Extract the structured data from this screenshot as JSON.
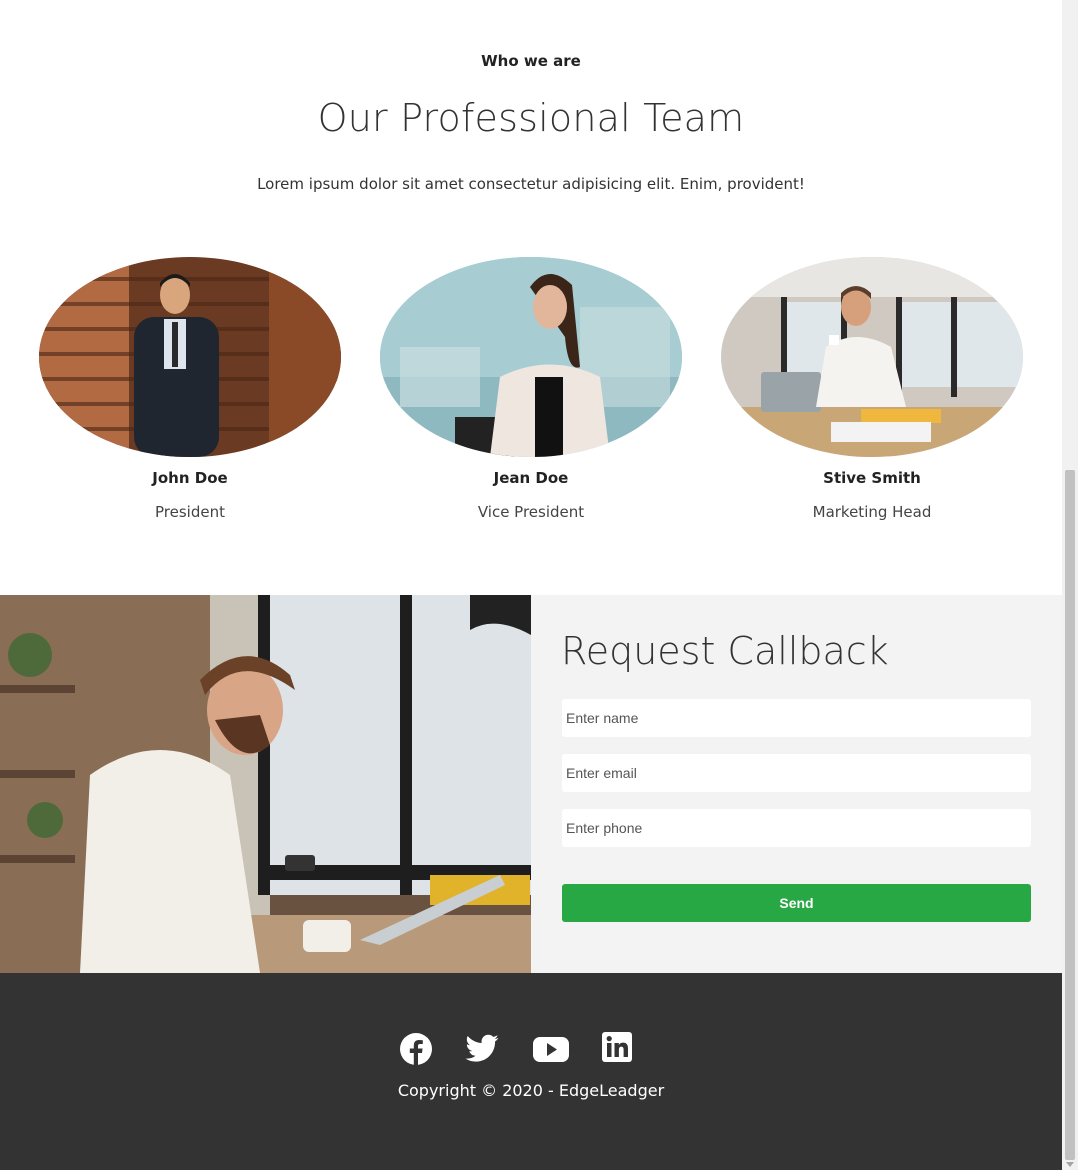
{
  "team_section": {
    "eyebrow": "Who we are",
    "title": "Our Professional Team",
    "subtitle": "Lorem ipsum dolor sit amet consectetur adipisicing elit. Enim, provident!",
    "members": [
      {
        "name": "John Doe",
        "role": "President"
      },
      {
        "name": "Jean Doe",
        "role": "Vice President"
      },
      {
        "name": "Stive Smith",
        "role": "Marketing Head"
      }
    ]
  },
  "callback": {
    "title": "Request Callback",
    "name_placeholder": "Enter name",
    "email_placeholder": "Enter email",
    "phone_placeholder": "Enter phone",
    "send_label": "Send"
  },
  "footer": {
    "social_icons": [
      "facebook-icon",
      "twitter-icon",
      "youtube-icon",
      "linkedin-icon"
    ],
    "copyright": "Copyright © 2020 - EdgeLeadger"
  },
  "colors": {
    "accent_green": "#28a745",
    "footer_bg": "#333333",
    "callback_bg": "#f3f3f3"
  }
}
